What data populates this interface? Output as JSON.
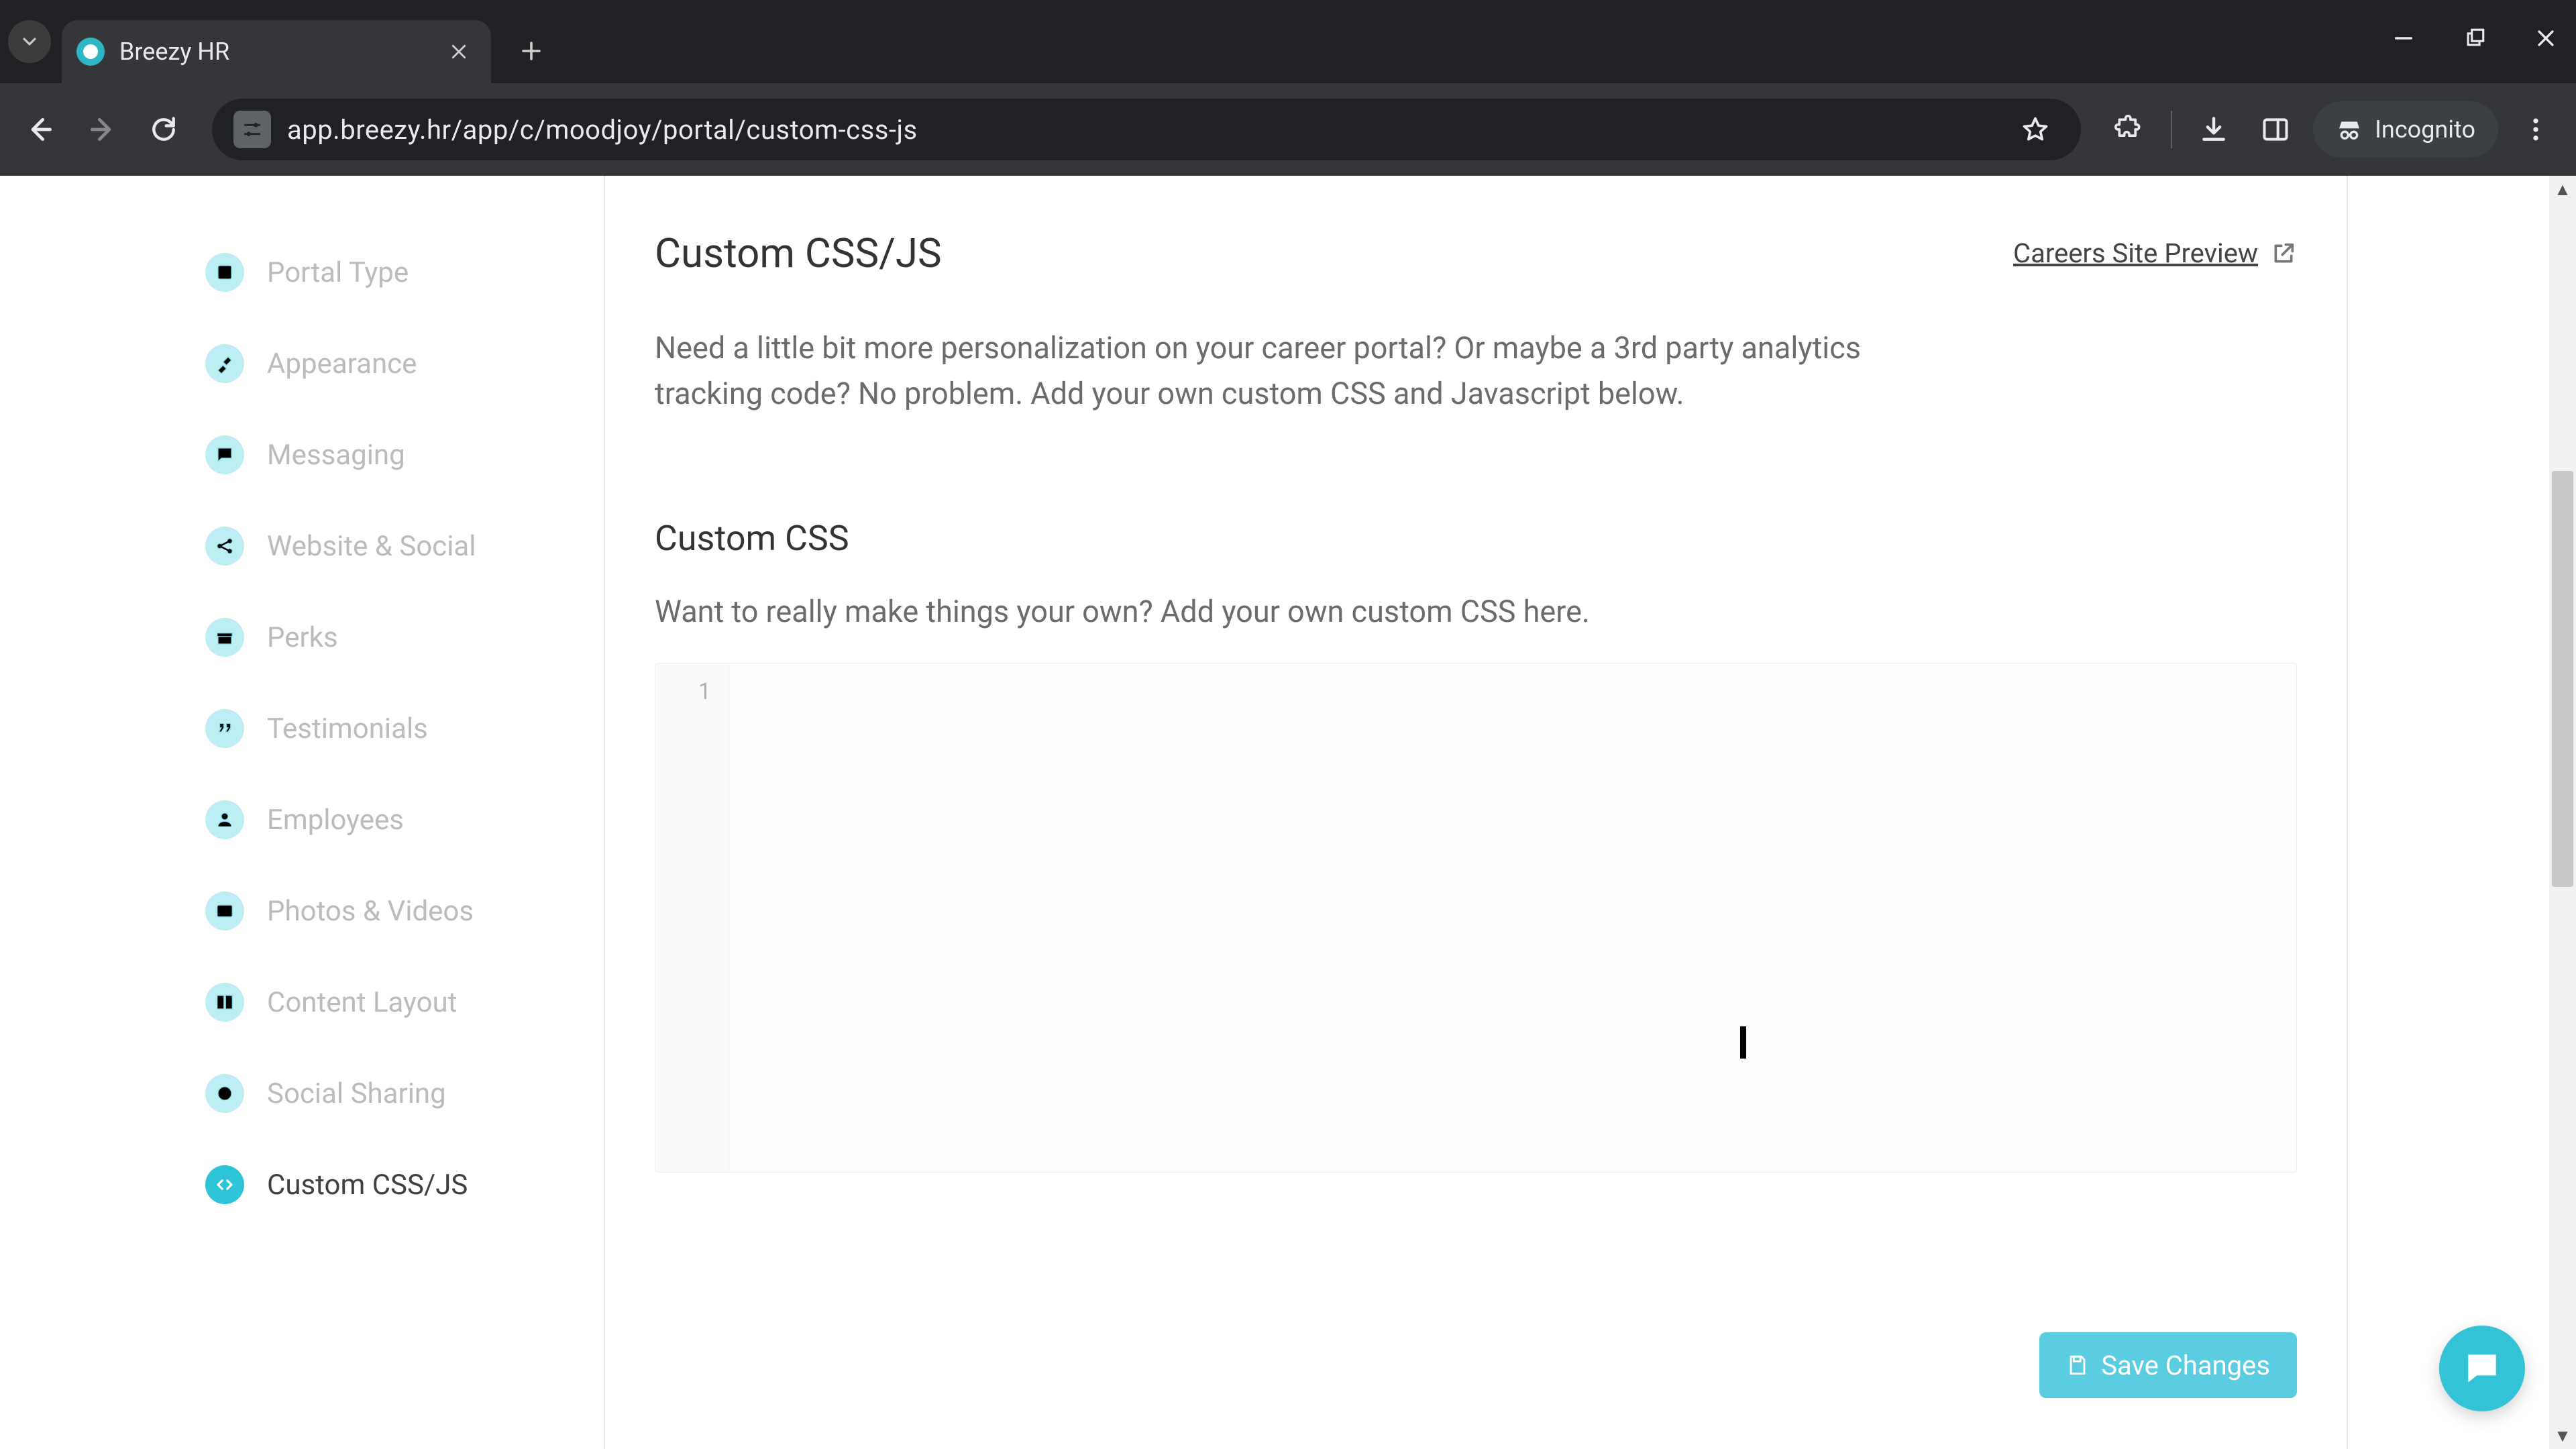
{
  "browser": {
    "tab_title": "Breezy HR",
    "url_display": "app.breezy.hr/app/c/moodjoy/portal/custom-css-js",
    "incognito_label": "Incognito"
  },
  "sidebar": {
    "items": [
      {
        "label": "Portal Type"
      },
      {
        "label": "Appearance"
      },
      {
        "label": "Messaging"
      },
      {
        "label": "Website & Social"
      },
      {
        "label": "Perks"
      },
      {
        "label": "Testimonials"
      },
      {
        "label": "Employees"
      },
      {
        "label": "Photos & Videos"
      },
      {
        "label": "Content Layout"
      },
      {
        "label": "Social Sharing"
      },
      {
        "label": "Custom CSS/JS"
      }
    ]
  },
  "main": {
    "title": "Custom CSS/JS",
    "preview_link": "Careers Site Preview",
    "lead": "Need a little bit more personalization on your career portal? Or maybe a 3rd party analytics tracking code? No problem. Add your own custom CSS and Javascript below.",
    "section_title": "Custom CSS",
    "section_desc": "Want to really make things your own? Add your own custom CSS here.",
    "editor_first_line": "1",
    "save_label": "Save Changes"
  },
  "colors": {
    "accent": "#2cc4d6",
    "accent_light": "#bdeef4",
    "save_bg": "#5bcde0"
  }
}
